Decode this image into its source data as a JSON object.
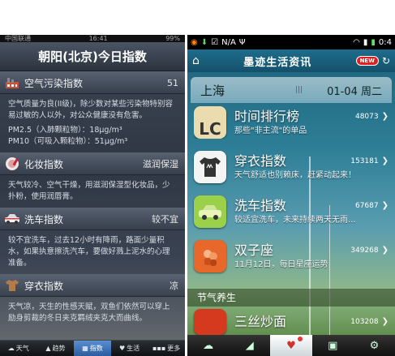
{
  "left": {
    "status": {
      "carrier": "中国联通",
      "time": "16:41",
      "battery": "99%"
    },
    "title": "朝阳(北京)今日指数",
    "indices": [
      {
        "name": "空气污染指数",
        "value": "51",
        "icon": "factory-icon",
        "desc": "空气质量为良(II级)，除少数对某些污染物特别容易过敏的人以外，对公众健康没有危害。",
        "pm": [
          "PM2.5（入肺颗粒物）：18μg/m³",
          "PM10（可吸入颗粒物）：51μg/m³"
        ]
      },
      {
        "name": "化妆指数",
        "value": "滋润保湿",
        "icon": "cosmetics-icon",
        "desc": "天气较冷、空气干燥，用滋润保湿型化妆品，少扑粉，使用润唇膏。"
      },
      {
        "name": "洗车指数",
        "value": "较不宜",
        "icon": "car-icon",
        "desc": "较不宜洗车，过去12小时有降雨，路面少量积水，如果执意擦洗汽车，要做好溅上泥水的心理准备。"
      },
      {
        "name": "穿衣指数",
        "value": "凉",
        "icon": "clothes-icon",
        "desc": "天气凉，天生的性感天赋，双鱼们依然可以穿上励身剪裁的冬日夹克羁绒夹克大而曲线。"
      }
    ],
    "tabs": [
      {
        "label": "天气",
        "icon": "cloud-icon",
        "active": false
      },
      {
        "label": "趋势",
        "icon": "trend-icon",
        "active": false
      },
      {
        "label": "指数",
        "icon": "index-icon",
        "active": true
      },
      {
        "label": "生活",
        "icon": "heart-icon",
        "active": false
      },
      {
        "label": "更多",
        "icon": "more-icon",
        "active": false
      }
    ]
  },
  "right": {
    "status": {
      "signal": "N/A",
      "time": "0:4"
    },
    "title": "墨迹生活资讯",
    "new_badge": "NEW",
    "city": "上海",
    "date": "01-04 周二",
    "items": [
      {
        "name": "时间排行榜",
        "count": "48073",
        "sub": "那些\"非主流\"的单品",
        "color": "#e8e0b0"
      },
      {
        "name": "穿衣指数",
        "count": "153181",
        "sub": "天气舒适也别赖床，赶紧动起来！",
        "color": "#f2f2f2"
      },
      {
        "name": "洗车指数",
        "count": "67687",
        "sub": "较适宜洗车，未来持续两天无雨...",
        "color": "#9bd14a"
      },
      {
        "name": "双子座",
        "count": "349268",
        "sub": "11月12日，每日星座运势",
        "color": "#e8672a"
      },
      {
        "name": "三丝炒面",
        "count": "103208",
        "sub": "",
        "color": "#d63a1e"
      }
    ],
    "section_title": "节气养生",
    "tabs": [
      {
        "icon": "cloud-icon",
        "active": false
      },
      {
        "icon": "chart-icon",
        "active": false
      },
      {
        "icon": "heart-icon",
        "active": true
      },
      {
        "icon": "toolbox-icon",
        "active": false
      },
      {
        "icon": "settings-icon",
        "active": false
      }
    ]
  }
}
